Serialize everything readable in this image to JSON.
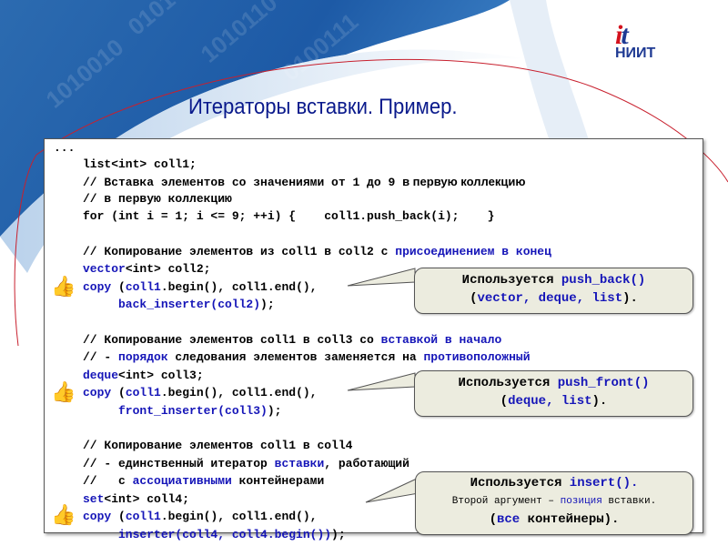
{
  "slide": {
    "title": "Итераторы  вставки. Пример.",
    "logo": {
      "mark_i": "i",
      "mark_t": "t",
      "text": "НИИТ"
    },
    "colors": {
      "title": "#0a1a8c",
      "keyword": "#1515b8",
      "callout_bg": "#ececdf",
      "thumb": "#1eb81e",
      "logo_red": "#d4121e",
      "logo_blue": "#1f3a93"
    }
  },
  "code": {
    "lines": [
      {
        "segments": [
          {
            "t": "...",
            "c": "plain"
          }
        ]
      },
      {
        "segments": [
          {
            "t": "list<int> coll1;",
            "c": "plain"
          }
        ]
      },
      {
        "segments": [
          {
            "t": "// Вставка элементов со значениями от 1 до 9 ",
            "c": "plain"
          },
          {
            "t": "в первую коллекцию",
            "c": "sans"
          }
        ]
      },
      {
        "segments": [
          {
            "t": "// в первую коллекцию",
            "c": "plain"
          }
        ]
      },
      {
        "segments": [
          {
            "t": "for (int i = 1; i <= 9; ++i) {    coll1.push_back(i);    }",
            "c": "plain"
          }
        ]
      },
      {
        "segments": []
      },
      {
        "segments": [
          {
            "t": "// Копирование элементов из coll1 в coll2 с ",
            "c": "plain"
          },
          {
            "t": "присоединением в конец",
            "c": "kw"
          }
        ]
      },
      {
        "segments": [
          {
            "t": "vector",
            "c": "kw"
          },
          {
            "t": "<int> coll2;",
            "c": "plain"
          }
        ]
      },
      {
        "segments": [
          {
            "t": "copy",
            "c": "kw"
          },
          {
            "t": " (",
            "c": "plain"
          },
          {
            "t": "coll1",
            "c": "kw"
          },
          {
            "t": ".begin(), coll1.end(),",
            "c": "plain"
          }
        ]
      },
      {
        "segments": [
          {
            "t": "     back_inserter(coll2)",
            "c": "kw"
          },
          {
            "t": ");",
            "c": "plain"
          }
        ]
      },
      {
        "segments": []
      },
      {
        "segments": [
          {
            "t": "// Копирование элементов coll1 в coll3 со ",
            "c": "plain"
          },
          {
            "t": "вставкой в начало",
            "c": "kw"
          }
        ]
      },
      {
        "segments": [
          {
            "t": "// - ",
            "c": "plain"
          },
          {
            "t": "порядок",
            "c": "kw"
          },
          {
            "t": " следования элементов заменяется на ",
            "c": "plain"
          },
          {
            "t": "противоположный",
            "c": "kw"
          }
        ]
      },
      {
        "segments": [
          {
            "t": "deque",
            "c": "kw"
          },
          {
            "t": "<int> coll3;",
            "c": "plain"
          }
        ]
      },
      {
        "segments": [
          {
            "t": "copy",
            "c": "kw"
          },
          {
            "t": " (",
            "c": "plain"
          },
          {
            "t": "coll1",
            "c": "kw"
          },
          {
            "t": ".begin(), coll1.end(),",
            "c": "plain"
          }
        ]
      },
      {
        "segments": [
          {
            "t": "     front_inserter(coll3)",
            "c": "kw"
          },
          {
            "t": ");",
            "c": "plain"
          }
        ]
      },
      {
        "segments": []
      },
      {
        "segments": [
          {
            "t": "// Копирование элементов coll1 в coll4",
            "c": "plain"
          }
        ]
      },
      {
        "segments": [
          {
            "t": "// - единственный итератор ",
            "c": "plain"
          },
          {
            "t": "вставки",
            "c": "kw"
          },
          {
            "t": ", работающий",
            "c": "plain"
          }
        ]
      },
      {
        "segments": [
          {
            "t": "//   с ",
            "c": "plain"
          },
          {
            "t": "ассоциативными",
            "c": "kw"
          },
          {
            "t": " контейнерами",
            "c": "plain"
          }
        ]
      },
      {
        "segments": [
          {
            "t": "set",
            "c": "kw"
          },
          {
            "t": "<int> coll4;",
            "c": "plain"
          }
        ]
      },
      {
        "segments": [
          {
            "t": "copy",
            "c": "kw"
          },
          {
            "t": " (",
            "c": "plain"
          },
          {
            "t": "coll1",
            "c": "kw"
          },
          {
            "t": ".begin(), coll1.end(),",
            "c": "plain"
          }
        ]
      },
      {
        "segments": [
          {
            "t": "     inserter(coll4, coll4.begin())",
            "c": "kw"
          },
          {
            "t": ");",
            "c": "plain"
          }
        ]
      }
    ]
  },
  "callouts": [
    {
      "line1_pre": "Используется ",
      "line1_kw": "push_back()",
      "line2_pre": "(",
      "line2_kw": "vector, deque, list",
      "line2_post": ")."
    },
    {
      "line1_pre": "Используется ",
      "line1_kw": "push_front()",
      "line2_pre": "(",
      "line2_kw": "deque, list",
      "line2_post": ")."
    },
    {
      "line1_pre": "Используется ",
      "line1_kw": "insert().",
      "line2_pre": "Второй аргумент – ",
      "line2_kw": "позиция",
      "line2_post": " вставки.",
      "line3_pre": "(",
      "line3_kw": "все",
      "line3_post": " контейнеры)."
    }
  ],
  "icons": {
    "thumb": "👍"
  }
}
